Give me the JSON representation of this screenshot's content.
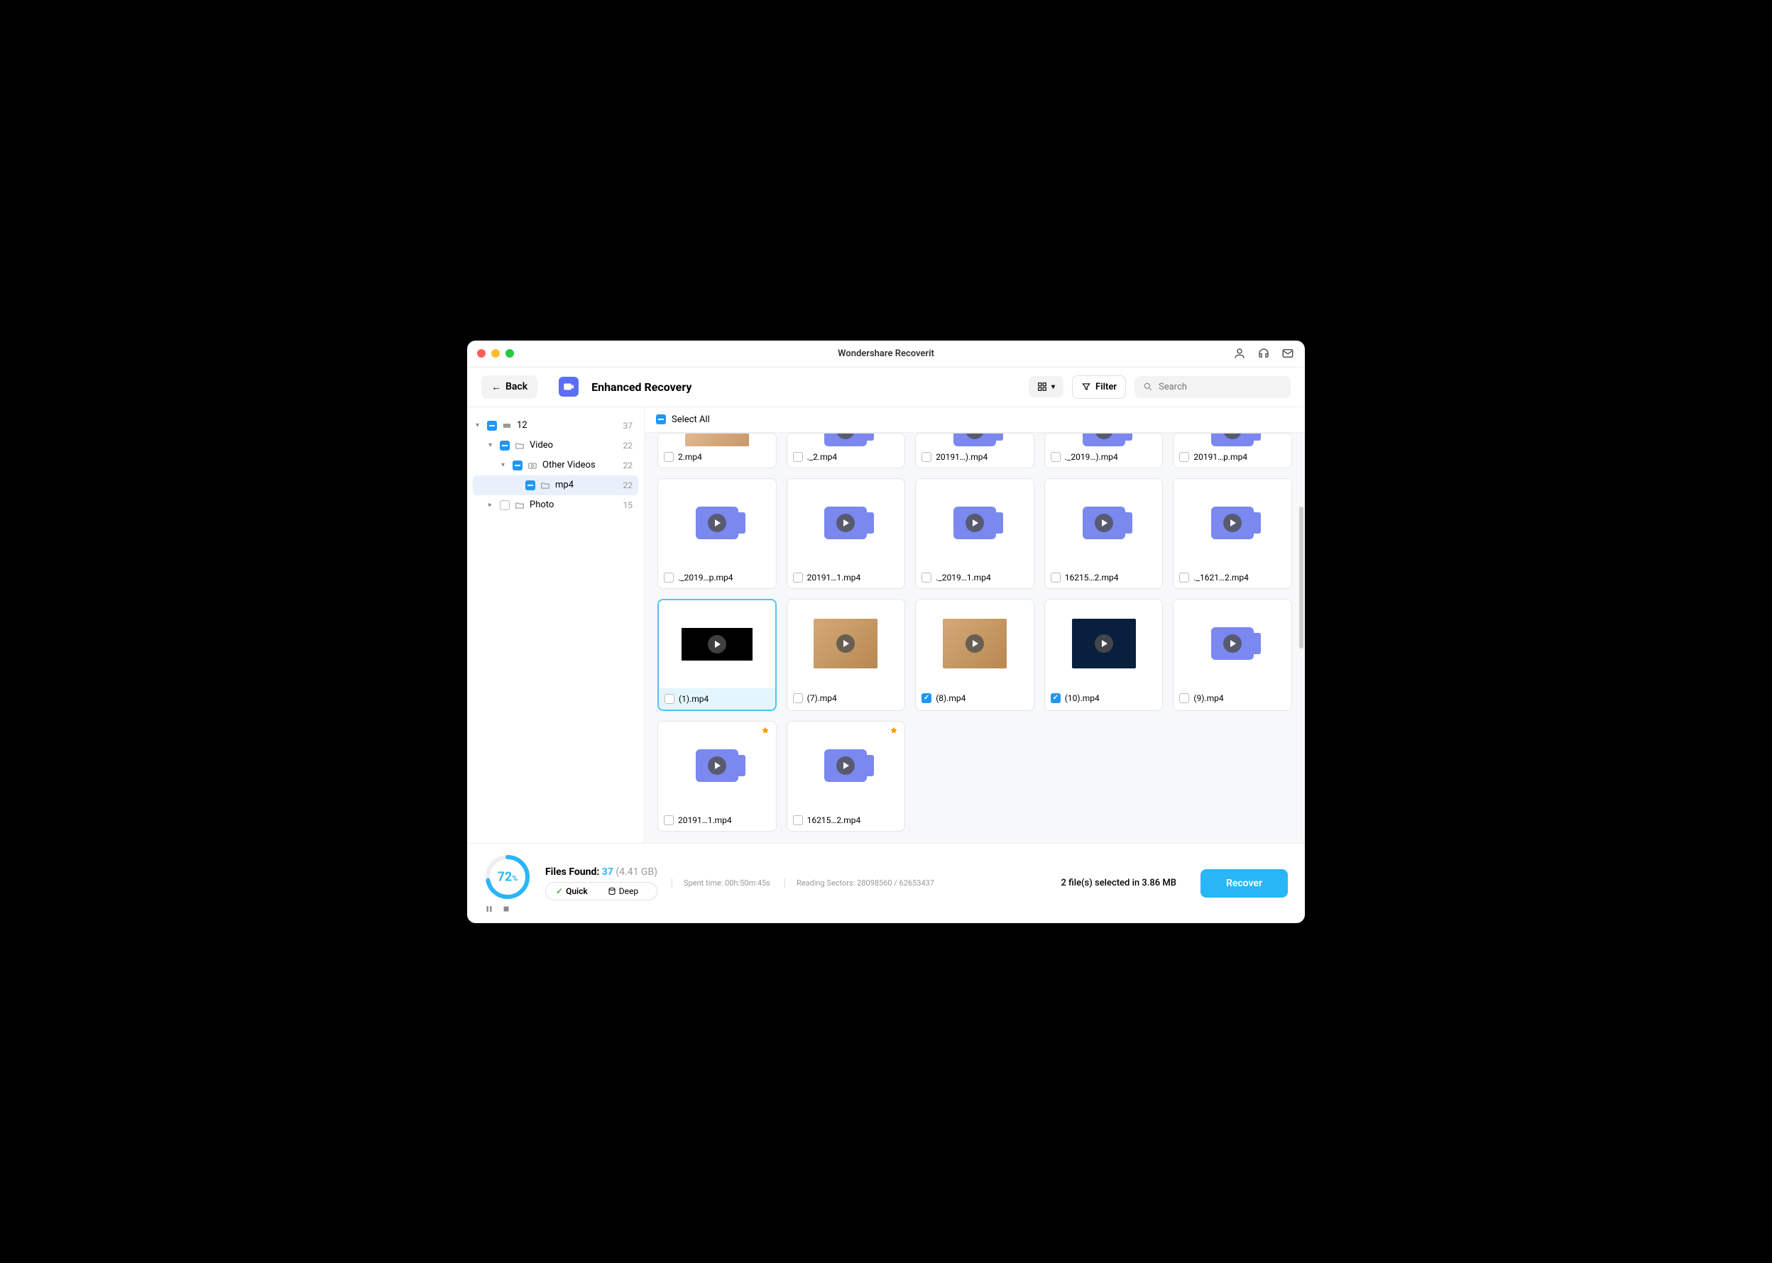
{
  "app_title": "Wondershare Recoverit",
  "back_label": "Back",
  "page_heading": "Enhanced Recovery",
  "filter_label": "Filter",
  "search_placeholder": "Search",
  "select_all_label": "Select All",
  "sidebar": [
    {
      "level": 1,
      "label": "12",
      "count": "37",
      "chk": "part",
      "icon": "drive",
      "arrow": "▾"
    },
    {
      "level": 2,
      "label": "Video",
      "count": "22",
      "chk": "part",
      "icon": "folder",
      "arrow": "▾"
    },
    {
      "level": 3,
      "label": "Other Videos",
      "count": "22",
      "chk": "part",
      "icon": "camera",
      "arrow": "▾"
    },
    {
      "level": 4,
      "label": "mp4",
      "count": "22",
      "chk": "part",
      "icon": "folder",
      "arrow": ""
    },
    {
      "level": 2,
      "label": "Photo",
      "count": "15",
      "chk": "empty",
      "icon": "folder",
      "arrow": "▸"
    }
  ],
  "files": [
    {
      "name": "2.mp4",
      "chk": "empty",
      "thumb": "cat",
      "short": true
    },
    {
      "name": "._2.mp4",
      "chk": "empty",
      "thumb": "icon",
      "short": true
    },
    {
      "name": "20191…).mp4",
      "chk": "empty",
      "thumb": "icon",
      "short": true
    },
    {
      "name": "._2019…).mp4",
      "chk": "empty",
      "thumb": "icon",
      "short": true
    },
    {
      "name": "20191…p.mp4",
      "chk": "empty",
      "thumb": "icon",
      "short": true
    },
    {
      "name": "._2019…p.mp4",
      "chk": "empty",
      "thumb": "icon"
    },
    {
      "name": "20191…1.mp4",
      "chk": "empty",
      "thumb": "icon"
    },
    {
      "name": "._2019…1.mp4",
      "chk": "empty",
      "thumb": "icon"
    },
    {
      "name": "16215…2.mp4",
      "chk": "empty",
      "thumb": "icon"
    },
    {
      "name": "._1621…2.mp4",
      "chk": "empty",
      "thumb": "icon"
    },
    {
      "name": "(1).mp4",
      "chk": "empty",
      "thumb": "black",
      "sel": true,
      "arrow": true
    },
    {
      "name": "(7).mp4",
      "chk": "empty",
      "thumb": "cat2"
    },
    {
      "name": "(8).mp4",
      "chk": "checked",
      "thumb": "cat2"
    },
    {
      "name": "(10).mp4",
      "chk": "checked",
      "thumb": "dark"
    },
    {
      "name": "(9).mp4",
      "chk": "empty",
      "thumb": "icon"
    },
    {
      "name": "20191…1.mp4",
      "chk": "empty",
      "thumb": "icon",
      "badge": true
    },
    {
      "name": "16215…2.mp4",
      "chk": "empty",
      "thumb": "icon",
      "badge": true
    }
  ],
  "footer": {
    "progress": "72",
    "files_found_label": "Files Found:",
    "files_found_count": "37",
    "files_found_size": "(4.41 GB)",
    "quick_label": "Quick",
    "deep_label": "Deep",
    "spent_time": "Spent time: 00h:50m:45s",
    "reading": "Reading Sectors: 28098560 / 62653437",
    "selected": "2 file(s) selected in 3.86 MB",
    "recover_label": "Recover"
  }
}
